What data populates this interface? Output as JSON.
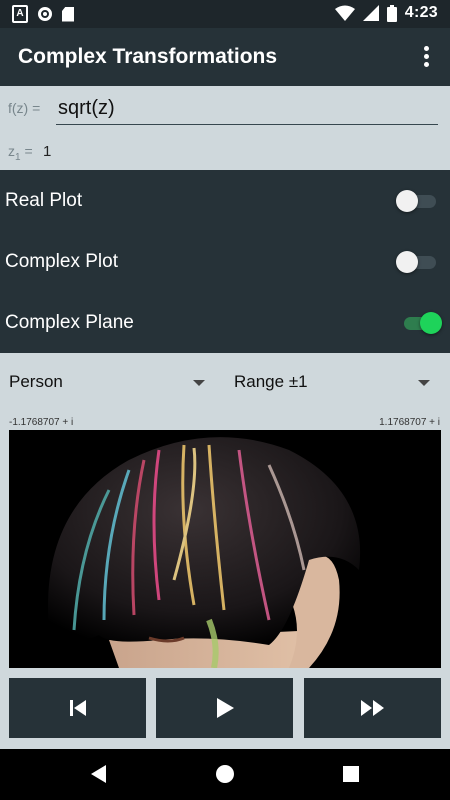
{
  "status_bar": {
    "time": "4:23",
    "notif_a": "A"
  },
  "app_bar": {
    "title": "Complex Transformations"
  },
  "function": {
    "label": "f(z) =",
    "value": "sqrt(z)"
  },
  "z1": {
    "label_main": "z",
    "label_sub": "1",
    "label_eq": "=",
    "value": "1"
  },
  "toggles": [
    {
      "label": "Real Plot",
      "on": false
    },
    {
      "label": "Complex Plot",
      "on": false
    },
    {
      "label": "Complex Plane",
      "on": true
    }
  ],
  "selectors": {
    "image": "Person",
    "range": "Range ±1"
  },
  "coords": {
    "left": "-1.1768707 + i",
    "right": "1.1768707 + i"
  },
  "controls": {
    "icons": [
      "skip-previous-icon",
      "play-icon",
      "fast-forward-icon"
    ]
  },
  "colors": {
    "app_bar": "#263238",
    "background": "#cfd8dc",
    "switch_on": "#1ed35a"
  }
}
